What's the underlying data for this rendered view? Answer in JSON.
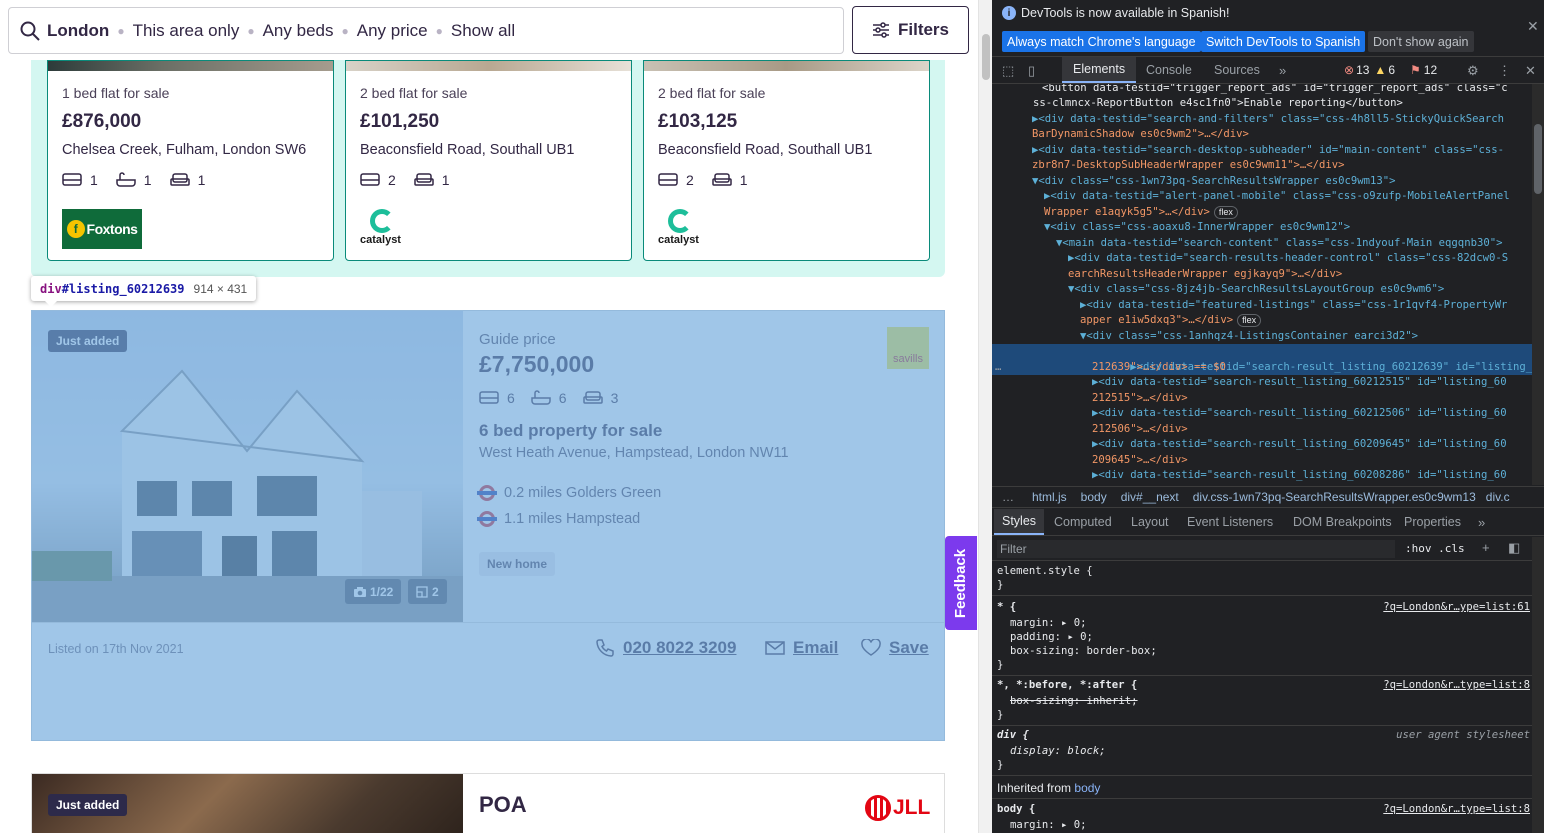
{
  "search": {
    "location": "London",
    "chips": [
      "This area only",
      "Any beds",
      "Any price",
      "Show all"
    ],
    "filters_label": "Filters"
  },
  "featured": [
    {
      "title": "1 bed flat for sale",
      "price": "£876,000",
      "address": "Chelsea Creek, Fulham, London SW6",
      "beds": "1",
      "baths": "1",
      "receptions": "1",
      "agent": "Foxtons"
    },
    {
      "title": "2 bed flat for sale",
      "price": "£101,250",
      "address": "Beaconsfield Road, Southall UB1",
      "beds": "2",
      "receptions": "1",
      "agent": "catalyst"
    },
    {
      "title": "2 bed flat for sale",
      "price": "£103,125",
      "address": "Beaconsfield Road, Southall UB1",
      "beds": "2",
      "receptions": "1",
      "agent": "catalyst"
    }
  ],
  "inspector_tooltip": {
    "tag": "div",
    "id": "#listing_60212639",
    "size": "914 × 431"
  },
  "listing": {
    "badge": "Just added",
    "photo_count": "1/22",
    "floorplan_count": "2",
    "price_label": "Guide price",
    "price": "£7,750,000",
    "beds": "6",
    "baths": "6",
    "receptions": "3",
    "title": "6 bed property for sale",
    "address": "West Heath Avenue, Hampstead, London NW11",
    "stations": [
      "0.2 miles Golders Green",
      "1.1 miles Hampstead"
    ],
    "tag": "New home",
    "agent": "savills",
    "listed": "Listed on 17th Nov 2021",
    "phone": "020 8022 3209",
    "email_label": "Email",
    "save_label": "Save"
  },
  "feedback_label": "Feedback",
  "next_listing": {
    "badge": "Just added",
    "price": "POA",
    "agent": "JLL"
  },
  "devtools": {
    "info_message": "DevTools is now available in Spanish!",
    "btn_match": "Always match Chrome's language",
    "btn_switch": "Switch DevTools to Spanish",
    "btn_dismiss": "Don't show again",
    "tabs": [
      "Elements",
      "Console",
      "Sources"
    ],
    "errors": "13",
    "warnings": "6",
    "issues": "12",
    "dom_lines": [
      "<button data-testid=\"trigger_report_ads\" id=\"trigger_report_ads\" class=\"c",
      "ss-clmncx-ReportButton e4sc1fn0\">Enable reporting</button>",
      "▶<div data-testid=\"search-and-filters\" class=\"css-4h8ll5-StickyQuickSearch",
      "BarDynamicShadow es0c9wm2\">…</div>",
      "▶<div data-testid=\"search-desktop-subheader\" id=\"main-content\" class=\"css-",
      "zbr8n7-DesktopSubHeaderWrapper es0c9wm11\">…</div>",
      "▼<div class=\"css-1wn73pq-SearchResultsWrapper es0c9wm13\">",
      "▶<div data-testid=\"alert-panel-mobile\" class=\"css-o9zufp-MobileAlertPanel",
      "Wrapper e1aqyk5g5\">…</div>",
      "▼<div class=\"css-aoaxu8-InnerWrapper es0c9wm12\">",
      "▼<main data-testid=\"search-content\" class=\"css-1ndyouf-Main eqgqnb30\">",
      "▶<div data-testid=\"search-results-header-control\" class=\"css-82dcw0-S",
      "earchResultsHeaderWrapper egjkayq9\">…</div>",
      "▼<div class=\"css-8jz4jb-SearchResultsLayoutGroup es0c9wm6\">",
      "▶<div data-testid=\"featured-listings\" class=\"css-1r1qvf4-PropertyWr",
      "apper e1iw5dxq3\">…</div>",
      "▼<div class=\"css-1anhqz4-ListingsContainer earci3d2\">",
      "▶<div data-testid=\"search-result_listing_60212639\" id=\"listing_60",
      "212639\">…</div> == $0",
      "▶<div data-testid=\"search-result_listing_60212515\" id=\"listing_60",
      "212515\">…</div>",
      "▶<div data-testid=\"search-result_listing_60212506\" id=\"listing_60",
      "212506\">…</div>",
      "▶<div data-testid=\"search-result_listing_60209645\" id=\"listing_60",
      "209645\">…</div>",
      "▶<div data-testid=\"search-result_listing_60208286\" id=\"listing_60"
    ],
    "flex_badge": "flex",
    "ellipsis": "…",
    "breadcrumbs": [
      "html.js",
      "body",
      "div#__next",
      "div.css-1wn73pq-SearchResultsWrapper.es0c9wm13",
      "div.c"
    ],
    "style_tabs": [
      "Styles",
      "Computed",
      "Layout",
      "Event Listeners",
      "DOM Breakpoints",
      "Properties"
    ],
    "filter_placeholder": "Filter",
    "hov_cls": ":hov  .cls",
    "rules": {
      "element_style": "element.style {",
      "close": "}",
      "star_sel": "* {",
      "margin": "margin: ▸ 0;",
      "padding": "padding: ▸ 0;",
      "box_sizing": "box-sizing: border-box;",
      "star_src": "?q=London&r…ype=list:61",
      "pseudo_sel": "*, *:before, *:after {",
      "pseudo_src": "?q=London&r…type=list:8",
      "box_inherit": "box-sizing: inherit;",
      "div_sel": "div {",
      "ua_label": "user agent stylesheet",
      "display": "display: block;",
      "inherited": "Inherited from",
      "inherited_from": "body",
      "body_sel": "body {",
      "body_src": "?q=London&r…type=list:8",
      "body_margin": "margin: ▸ 0;"
    }
  }
}
